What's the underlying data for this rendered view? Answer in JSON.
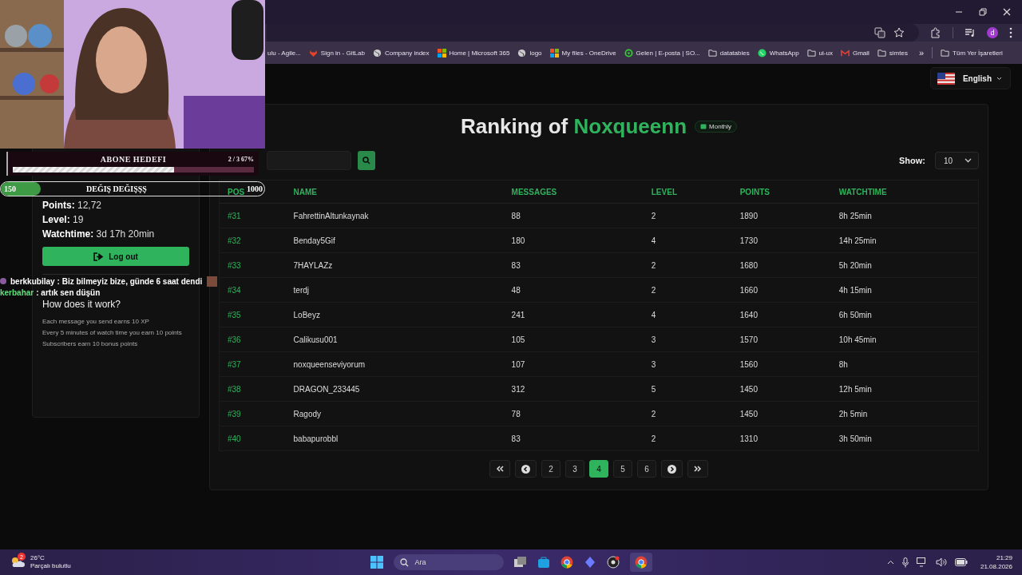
{
  "browser": {
    "avatar": "d",
    "bookmarks": [
      {
        "label": "ulu - Agile...",
        "kind": "none"
      },
      {
        "label": "Sign in - GitLab",
        "kind": "gitlab"
      },
      {
        "label": "Company index",
        "kind": "globe"
      },
      {
        "label": "Home | Microsoft 365",
        "kind": "microsoft"
      },
      {
        "label": "logo",
        "kind": "globe"
      },
      {
        "label": "My files - OneDrive",
        "kind": "microsoft"
      },
      {
        "label": "Gelen | E-posta | SO...",
        "kind": "ring"
      },
      {
        "label": "datatables",
        "kind": "folder"
      },
      {
        "label": "WhatsApp",
        "kind": "whatsapp"
      },
      {
        "label": "ui-ux",
        "kind": "folder"
      },
      {
        "label": "Gmail",
        "kind": "gmail"
      },
      {
        "label": "simtes",
        "kind": "folder"
      }
    ],
    "more": "»",
    "all_bookmarks": "Tüm Yer İşaretleri"
  },
  "language": {
    "label": "English"
  },
  "profile": {
    "points_label": "Points:",
    "points": "12,72",
    "level_label": "Level:",
    "level": "19",
    "watchtime_label": "Watchtime:",
    "watchtime": "3d 17h 20min",
    "logout": "Log out"
  },
  "help": {
    "title": "How does it work?",
    "lines": [
      "Each message you send earns 10 XP",
      "Every 5 minutes of watch time you earn 10 points",
      "Subscribers earn 10 bonus points"
    ]
  },
  "ranking": {
    "title": "Ranking of",
    "streamer": "Noxqueenn",
    "period": "Monthly",
    "show_label": "Show:",
    "show_value": "10",
    "columns": [
      "POS",
      "NAME",
      "MESSAGES",
      "LEVEL",
      "POINTS",
      "WATCHTIME"
    ],
    "rows": [
      [
        "#31",
        "FahrettinAltunkaynak",
        "88",
        "2",
        "1890",
        "8h 25min"
      ],
      [
        "#32",
        "Benday5Gif",
        "180",
        "4",
        "1730",
        "14h 25min"
      ],
      [
        "#33",
        "7HAYLAZz",
        "83",
        "2",
        "1680",
        "5h 20min"
      ],
      [
        "#34",
        "terdj",
        "48",
        "2",
        "1660",
        "4h 15min"
      ],
      [
        "#35",
        "LoBeyz",
        "241",
        "4",
        "1640",
        "6h 50min"
      ],
      [
        "#36",
        "Calikusu001",
        "105",
        "3",
        "1570",
        "10h 45min"
      ],
      [
        "#37",
        "noxqueenseviyorum",
        "107",
        "3",
        "1560",
        "8h"
      ],
      [
        "#38",
        "DRAGON_233445",
        "312",
        "5",
        "1450",
        "12h 5min"
      ],
      [
        "#39",
        "Ragody",
        "78",
        "2",
        "1450",
        "2h 5min"
      ],
      [
        "#40",
        "babapurobbl",
        "83",
        "2",
        "1310",
        "3h 50min"
      ]
    ],
    "pages": [
      {
        "label": "2",
        "selected": false
      },
      {
        "label": "3",
        "selected": false
      },
      {
        "label": "4",
        "selected": true
      },
      {
        "label": "5",
        "selected": false
      },
      {
        "label": "6",
        "selected": false
      }
    ]
  },
  "overlay": {
    "goal": {
      "title": "ABONE HEDEFI",
      "count": "2 / 3",
      "percent": "67%",
      "level": 0.67
    },
    "goal2": {
      "start": "150",
      "title": "DEĞIŞ DEĞIŞŞŞ",
      "end": "1000",
      "level": 0.15
    },
    "chat": [
      {
        "user": "berkkubilay",
        "color": "#ffffff",
        "text": ": Biz bilmeyiz bize, günde 6 saat dendi"
      },
      {
        "user": "kerbahar",
        "color": "#5fe07c",
        "text": ": artık sen düşün"
      }
    ]
  },
  "taskbar": {
    "weather_badge": "2",
    "temperature": "26°C",
    "weather": "Parçalı bulutlu",
    "search": "Ara",
    "time": "21:29",
    "date": "21.08.2026"
  }
}
